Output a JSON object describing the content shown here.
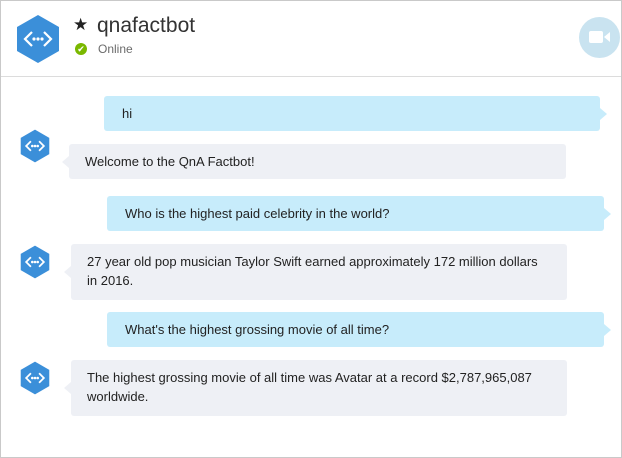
{
  "header": {
    "bot_name": "qnafactbot",
    "status": "Online",
    "favorite_icon": "star-icon",
    "video_icon": "video-camera-icon",
    "avatar_icon": "bot-hexagon-icon"
  },
  "colors": {
    "avatar_blue": "#3b8fd9",
    "user_bubble": "#c7ecfb",
    "bot_bubble": "#eef0f5",
    "online_green": "#7ab800",
    "video_button": "#c9e3f0"
  },
  "messages": [
    {
      "from": "user",
      "text": "hi"
    },
    {
      "from": "bot",
      "text": "Welcome to the QnA Factbot!"
    },
    {
      "from": "user",
      "text": "Who is the highest paid celebrity in the world?"
    },
    {
      "from": "bot",
      "text": "27 year old pop musician Taylor Swift earned approximately 172 million dollars in 2016."
    },
    {
      "from": "user",
      "text": "What's the highest grossing movie of all time?"
    },
    {
      "from": "bot",
      "text": "The highest grossing movie of all time was Avatar at a record $2,787,965,087 worldwide."
    }
  ]
}
